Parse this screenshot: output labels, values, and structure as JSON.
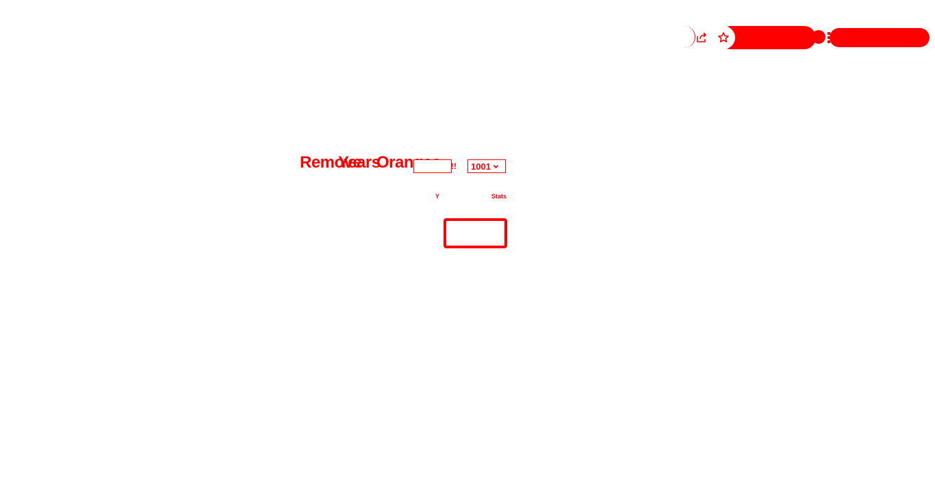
{
  "browser": {
    "icons": {
      "share": "share-icon",
      "bookmark": "star-icon",
      "menu": "kebab-menu-icon"
    },
    "accent_color": "#ff0000"
  },
  "page": {
    "heading_layers": [
      "Remove",
      "Years",
      "Oranges"
    ],
    "exclaim": "!!",
    "year_select": {
      "selected": "1001"
    },
    "label_left": "Y",
    "label_right": "Stats",
    "button_label": ""
  }
}
